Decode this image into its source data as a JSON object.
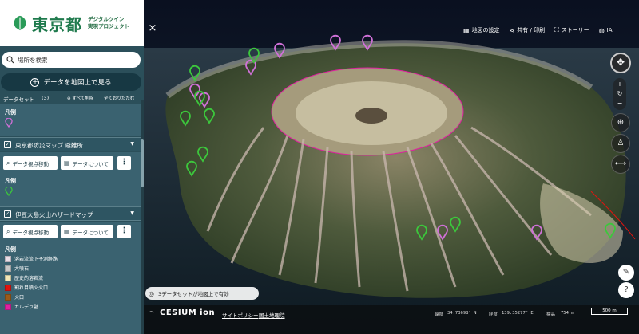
{
  "brand": {
    "name": "東京都",
    "sub1": "デジタルツイン",
    "sub2": "実現プロジェクト",
    "color": "#1f7a4d"
  },
  "search": {
    "placeholder": "場所を検索",
    "icon": "search-icon"
  },
  "view_data_button": "データを地図上で見る",
  "datasets": {
    "title": "データセット",
    "count": "(3)",
    "delete_all": "すべて削除",
    "collapse_all": "全ておりたたむ",
    "legend_label": "凡例"
  },
  "layers": [
    {
      "name": "東京都防災マップ 避難所",
      "btn_move": "データ視点移動",
      "btn_about": "データについて",
      "legend": "凡例",
      "pin_color": "#3cc73c"
    },
    {
      "name": "伊豆大島火山ハザードマップ",
      "btn_move": "データ視点移動",
      "btn_about": "データについて",
      "legend": "凡例",
      "hazard_items": [
        {
          "label": "溶岩流流下予測経路",
          "color": "#e8dde6"
        },
        {
          "label": "大噴石",
          "color": "#c8c8c8"
        },
        {
          "label": "歴史的溶岩流",
          "color": "#f2e8b8"
        },
        {
          "label": "割れ目噴火火口",
          "color": "#e0140f"
        },
        {
          "label": "火口",
          "color": "#9a5a1a"
        },
        {
          "label": "カルデラ壁",
          "color": "#e020a0"
        }
      ]
    }
  ],
  "toolbar": {
    "map_settings": "地図の設定",
    "share_print": "共有 / 印刷",
    "story": "ストーリー",
    "user": "IA"
  },
  "data_status": "3データセットが地図上で有効",
  "footer": {
    "cesium": "CESIUM ion",
    "site_policy": "サイトポリシー",
    "data_attr": "国土地理院",
    "lat_label": "緯度",
    "lat_value": "34.73698° N",
    "lon_label": "経度",
    "lon_value": "139.35277° E",
    "elev_label": "標高",
    "elev_value": "754 m",
    "scale": "500 m"
  },
  "pin_colors": {
    "shelter": "#3cc73c",
    "dataset1": "#d070d8"
  }
}
